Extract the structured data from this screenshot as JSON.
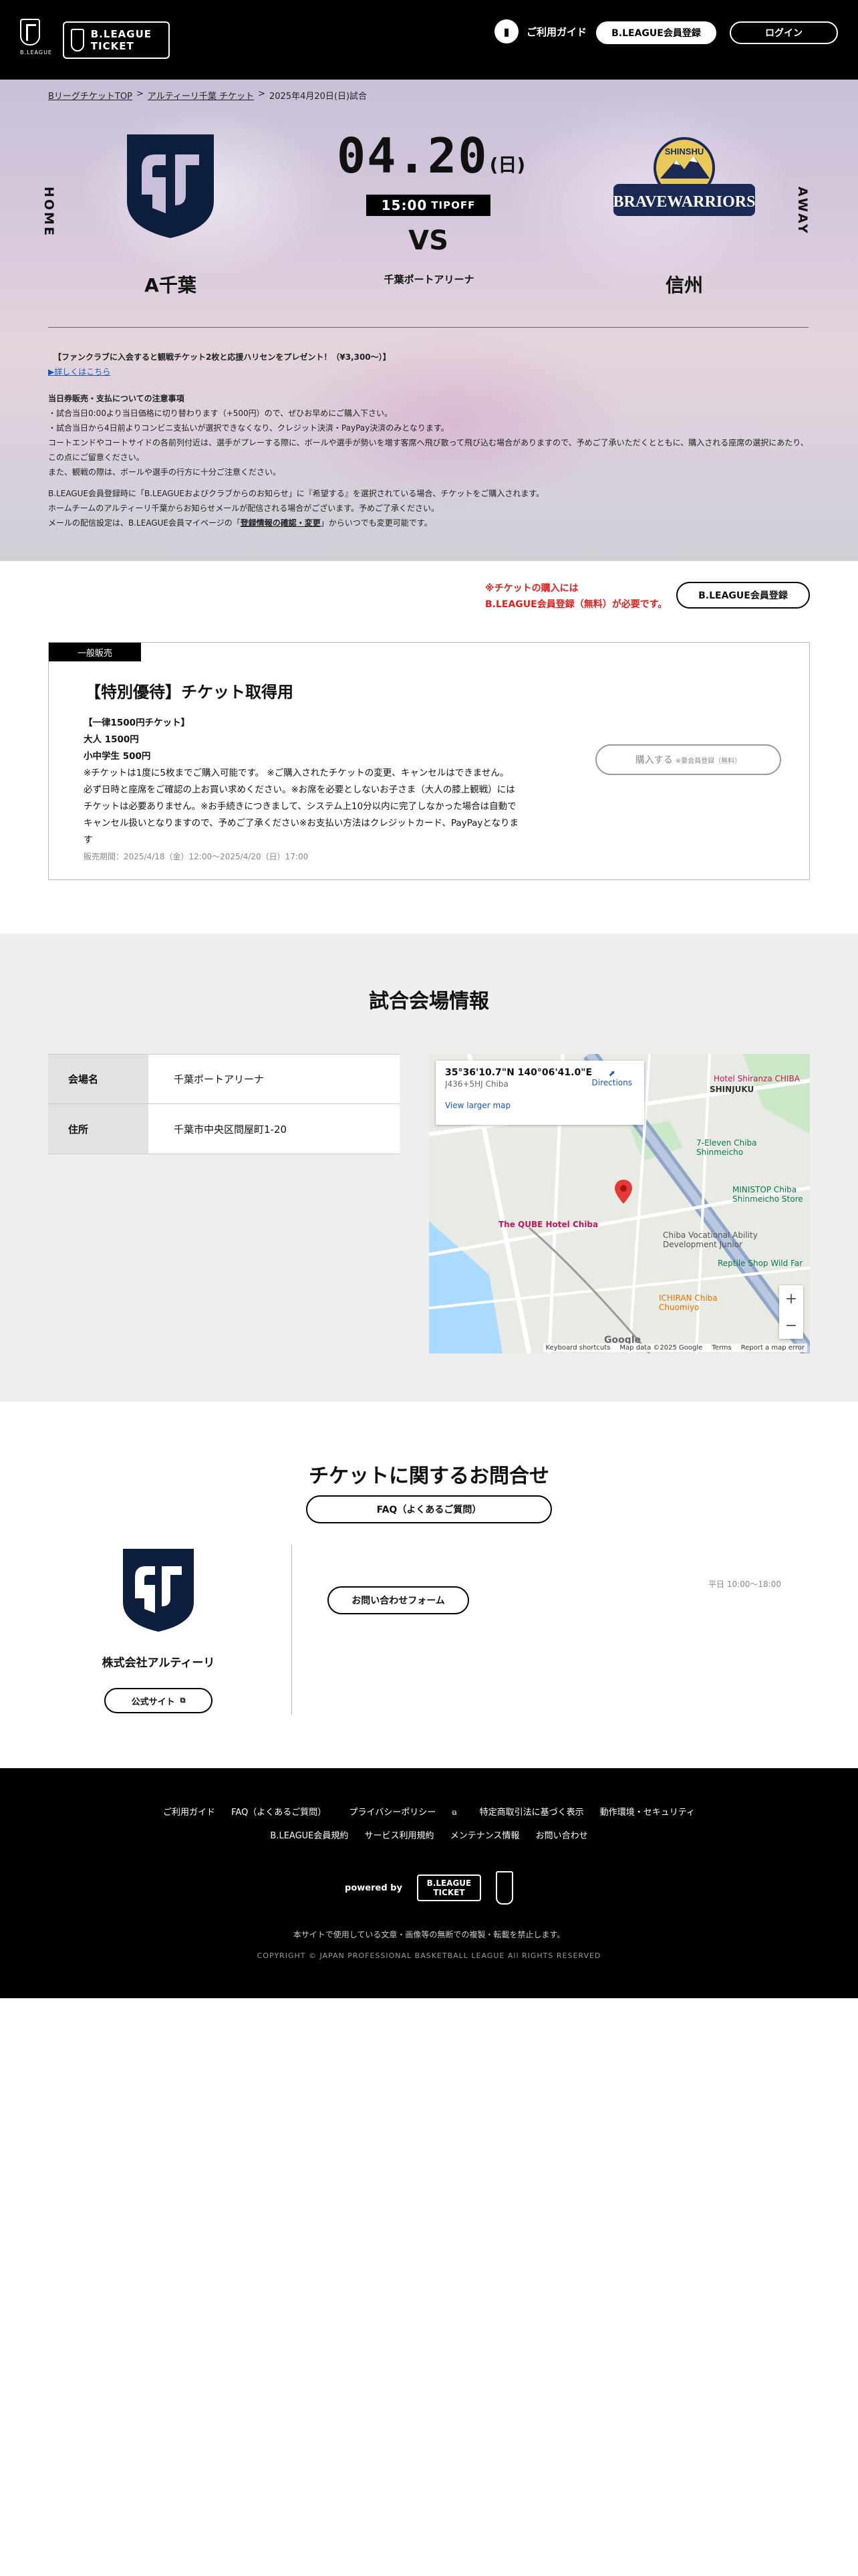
{
  "header": {
    "bleague_logo_text": "B.LEAGUE",
    "ticket_logo": "B.LEAGUE TICKET",
    "guide_label": "ご利用ガイド",
    "register_label": "B.LEAGUE会員登録",
    "login_label": "ログイン"
  },
  "breadcrumb": {
    "top": "BリーグチケットTOP",
    "team": "アルティーリ千葉 チケット",
    "current": "2025年4月20日(日)試合",
    "sep": ">"
  },
  "match": {
    "home_label": "HOME",
    "away_label": "AWAY",
    "home_team": "A千葉",
    "away_team": "信州",
    "date": "04.20",
    "weekday": "(日)",
    "time": "15:00",
    "tipoff": "TIPOFF",
    "vs": "VS",
    "arena": "千葉ポートアリーナ",
    "away_logo_top": "SHINSHU",
    "away_logo_main": "BRAVEWARRIORS"
  },
  "notes": {
    "campaign": "【ファンクラブに入会すると観戦チケット2枚と応援ハリセンをプレゼント！（¥3,300〜）】",
    "more": "▶詳しくはこちら",
    "heading": "当日券販売・支払についての注意事項",
    "line1": "・試合当日0:00より当日価格に切り替わります（+500円）ので、ぜひお早めにご購入下さい。",
    "line2": "・試合当日から4日前よりコンビニ支払いが選択できなくなり、クレジット決済・PayPay決済のみとなります。",
    "line3": "コートエンドやコートサイドの各前列付近は、選手がプレーする際に、ボールや選手が勢いを増す客席へ飛び散って飛び込む場合がありますので、予めご了承いただくとともに、購入される座席の選択にあたり、",
    "line4": "この点にご留意ください。",
    "line5": "また、観戦の際は、ボールや選手の行方に十分ご注意ください。",
    "line6": "B.LEAGUE会員登録時に「B.LEAGUEおよびクラブからのお知らせ」に『希望する』を選択されている場合、チケットをご購入されます。",
    "line7": "ホームチームのアルティーリ千葉からお知らせメールが配信される場合がございます。予めご了承ください。",
    "line8a": "メールの配信設定は、B.LEAGUE会員マイページの「",
    "line8link": "登録情報の確認・変更",
    "line8b": "」からいつでも変更可能です。"
  },
  "ticket_notice": {
    "line1": "※チケットの購入には",
    "line2": "B.LEAGUE会員登録（無料）が必要です。",
    "register_label": "B.LEAGUE会員登録"
  },
  "ticket_card": {
    "tag": "一般販売",
    "title": "【特別優待】チケット取得用",
    "l1": "【一律1500円チケット】",
    "l2": "大人 1500円",
    "l3": "小中学生 500円",
    "l4": "※チケットは1度に5枚までご購入可能です。 ※ご購入されたチケットの変更、キャンセルはできません。",
    "l5": "必ず日時と座席をご確認の上お買い求めください。※お席を必要としないお子さま（大人の膝上観戦）には",
    "l6": "チケットは必要ありません。※お手続きにつきまして、システム上10分以内に完了しなかった場合は自動で",
    "l7": "キャンセル扱いとなりますので、予めご了承ください※お支払い方法はクレジットカード、PayPayとなりま",
    "l8": "す",
    "period": "販売期間：2025/4/18（金）12:00〜2025/4/20（日）17:00",
    "buy_label": "購入する",
    "buy_sub": "※要会員登録（無料）"
  },
  "venue": {
    "heading": "試合会場情報",
    "rows": [
      {
        "th": "会場名",
        "td": "千葉ポートアリーナ"
      },
      {
        "th": "住所",
        "td": "千葉市中央区問屋町1-20"
      }
    ],
    "map": {
      "coord": "35°36'10.7\"N 140°06'41.0\"E",
      "plus": "J436+5HJ Chiba",
      "larger": "View larger map",
      "directions": "Directions",
      "hotel": "The QUBE Hotel Chiba",
      "shinjuku": "SHINJUKU",
      "eleven": "7-Eleven Chiba Shinmeicho",
      "ministop": "MINISTOP Chiba Shinmeicho Store",
      "hotel2": "Hotel Shiranza CHIBA",
      "reptile": "Reptile Shop Wild Far",
      "ichiran": "ICHIRAN Chiba Chuomiyo",
      "school": "Chiba Vocational Ability Development Junior",
      "google": "Google",
      "shortcuts": "Keyboard shortcuts",
      "mapdata": "Map data ©2025 Google",
      "terms": "Terms",
      "report": "Report a map error"
    }
  },
  "contact": {
    "heading": "チケットに関するお問合せ",
    "faq_label": "FAQ（よくあるご質問）",
    "company": "株式会社アルティーリ",
    "site_label": "公式サイト",
    "form_label": "お問い合わせフォーム",
    "hours": "平日 10:00〜18:00"
  },
  "footer": {
    "links1": [
      "ご利用ガイド",
      "FAQ（よくあるご質問）",
      "プライバシーポリシー",
      "特定商取引法に基づく表示",
      "動作環境・セキュリティ"
    ],
    "links2": [
      "B.LEAGUE会員規約",
      "サービス利用規約",
      "メンテナンス情報",
      "お問い合わせ"
    ],
    "powered": "powered by",
    "ticket_logo": "B.LEAGUE TICKET",
    "note": "本サイトで使用している文章・画像等の無断での複製・転載を禁止します。",
    "copyright": "COPYRIGHT © JAPAN PROFESSIONAL BASKETBALL LEAGUE All RIGHTS RESERVED"
  }
}
